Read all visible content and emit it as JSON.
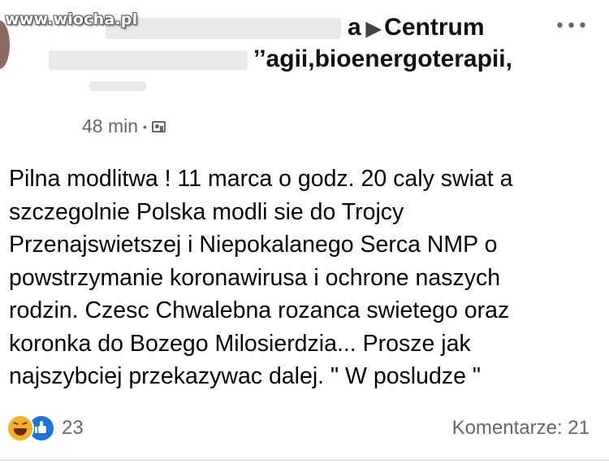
{
  "watermark": "www.wiocha.pl",
  "header": {
    "line1_text": "a",
    "line1_target": "Centrum",
    "line2": "’’agii,bioenergoterapii,",
    "more_icon": "more-horizontal-icon"
  },
  "meta": {
    "time": "48 min",
    "separator": "•",
    "privacy_icon": "photo-icon"
  },
  "post": {
    "text": "Pilna modlitwa ! 11 marca o godz. 20 caly swiat a\nszczegolnie Polska modli sie do Trojcy\nPrzenajswietszej i Niepokalanego Serca NMP o\npowstrzymanie koronawirusa i ochrone naszych\nrodzin.  Czesc  Chwalebna rozanca swietego oraz\nkoronka do Bozego Milosierdzia... Prosze jak\nnajszybciej przekazywac dalej.    \" W posludze \""
  },
  "footer": {
    "reactions_count": "23",
    "reaction_icons": [
      "haha-icon",
      "like-icon"
    ],
    "comments_label": "Komentarze: 21"
  },
  "colors": {
    "like_blue": "#1b74e4",
    "haha_yellow": "#f7b125",
    "secondary_text": "#65676b"
  }
}
